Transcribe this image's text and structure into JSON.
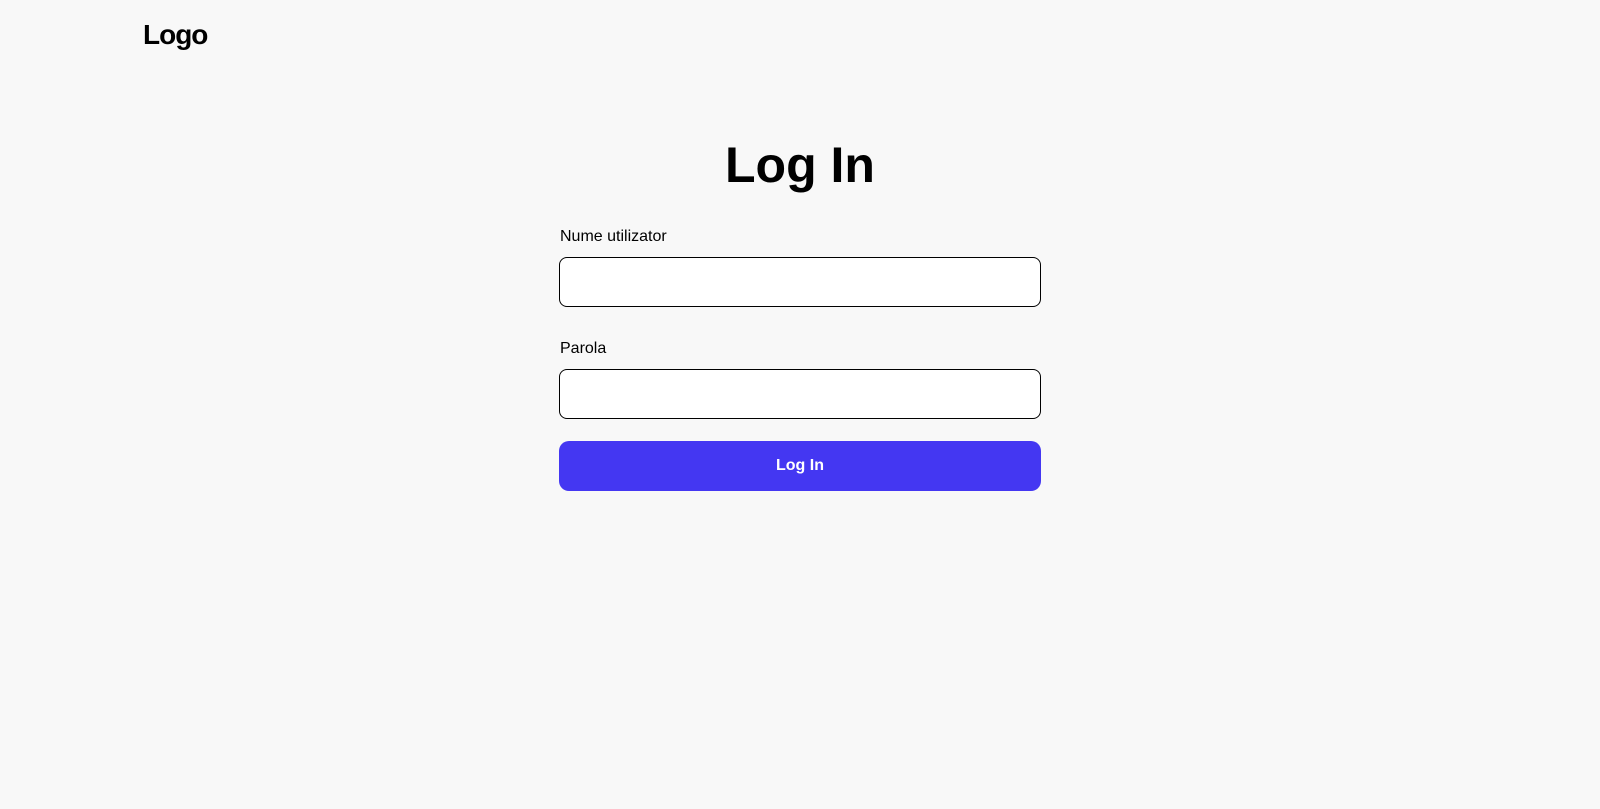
{
  "header": {
    "logo_text": "Logo"
  },
  "login": {
    "title": "Log In",
    "username_label": "Nume utilizator",
    "username_value": "",
    "password_label": "Parola",
    "password_value": "",
    "submit_label": "Log In"
  },
  "colors": {
    "background": "#f8f8f8",
    "primary_button": "#4437f2",
    "button_text": "#ffffff",
    "input_border": "#000000"
  }
}
